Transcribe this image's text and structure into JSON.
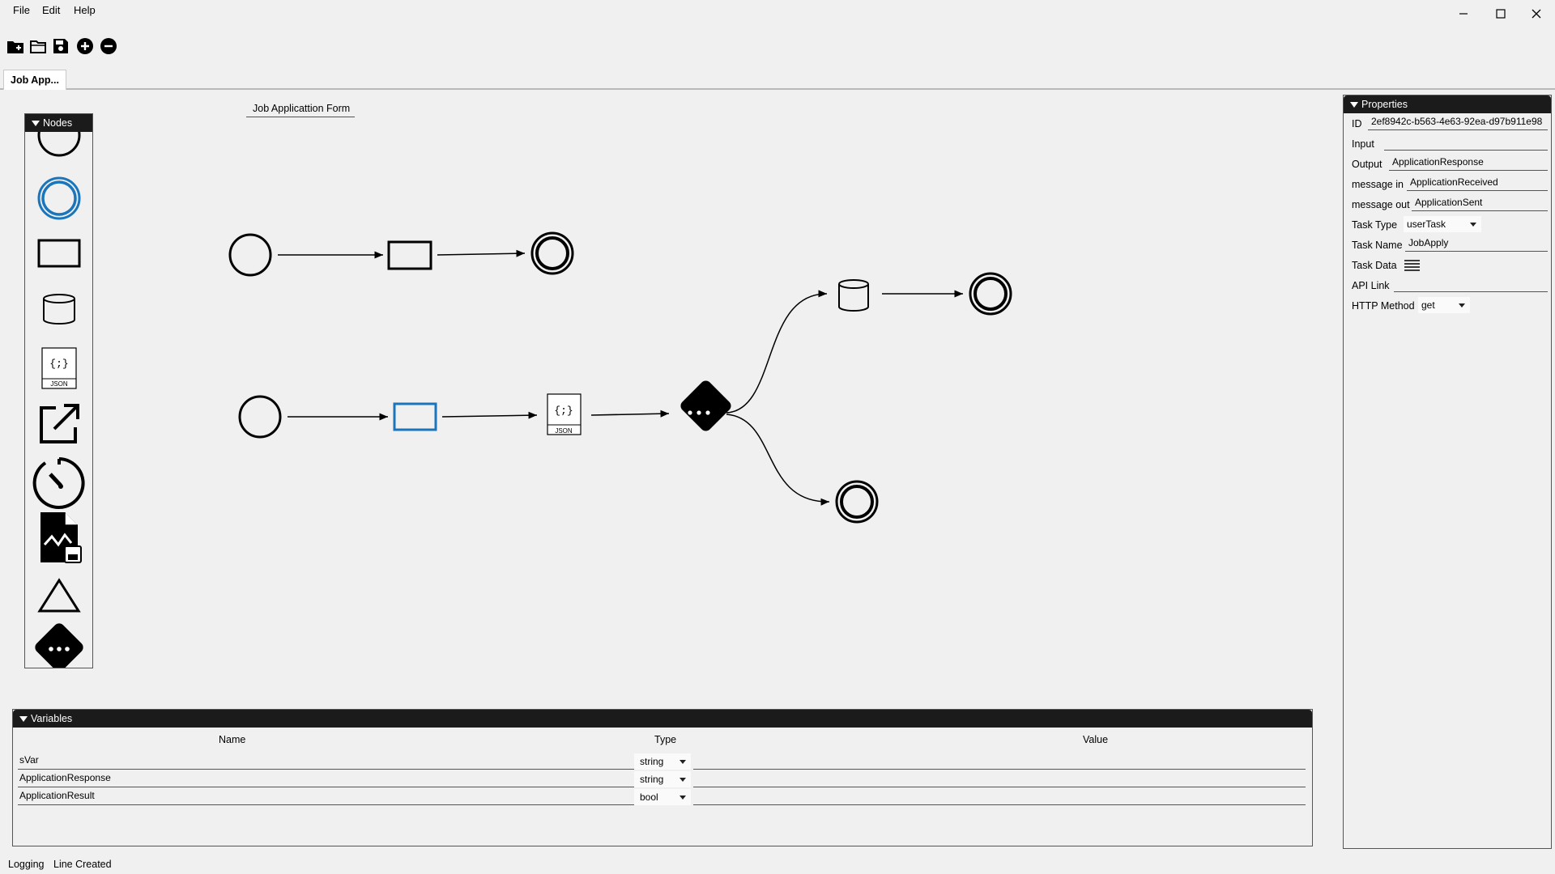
{
  "menu": {
    "file": "File",
    "edit": "Edit",
    "help": "Help"
  },
  "toolbar": {
    "icons": [
      "new-folder-icon",
      "open-folder-icon",
      "save-icon",
      "zoom-in-icon",
      "zoom-out-icon"
    ]
  },
  "tabs": [
    {
      "label": "Job App..."
    }
  ],
  "nodes_panel": {
    "title": "Nodes",
    "items": [
      "start-event",
      "intermediate-event",
      "task",
      "data-store",
      "json-object",
      "external-link",
      "timer",
      "chart-document",
      "triangle",
      "gateway"
    ],
    "json_label": "JSON"
  },
  "canvas": {
    "title": "Job Applicattion Form",
    "json_label": "JSON"
  },
  "properties": {
    "title": "Properties",
    "id_label": "ID",
    "id_value": "2ef8942c-b563-4e63-92ea-d97b911e98",
    "input_label": "Input",
    "input_value": "",
    "output_label": "Output",
    "output_value": "ApplicationResponse",
    "message_in_label": "message in",
    "message_in_value": "ApplicationReceived",
    "message_out_label": "message out",
    "message_out_value": "ApplicationSent",
    "task_type_label": "Task Type",
    "task_type_value": "userTask",
    "task_name_label": "Task Name",
    "task_name_value": "JobApply",
    "task_data_label": "Task Data",
    "api_link_label": "API Link",
    "api_link_value": "",
    "http_method_label": "HTTP Method",
    "http_method_value": "get"
  },
  "variables": {
    "title": "Variables",
    "columns": {
      "name": "Name",
      "type": "Type",
      "value": "Value"
    },
    "rows": [
      {
        "name": "sVar",
        "type": "string",
        "value": ""
      },
      {
        "name": "ApplicationResponse",
        "type": "string",
        "value": ""
      },
      {
        "name": "ApplicationResult",
        "type": "bool",
        "value": ""
      }
    ]
  },
  "status": {
    "logging": "Logging",
    "message": "Line Created"
  },
  "colors": {
    "selected": "#1b75bb",
    "header": "#1b1b1b",
    "background": "#f0f0f0"
  }
}
